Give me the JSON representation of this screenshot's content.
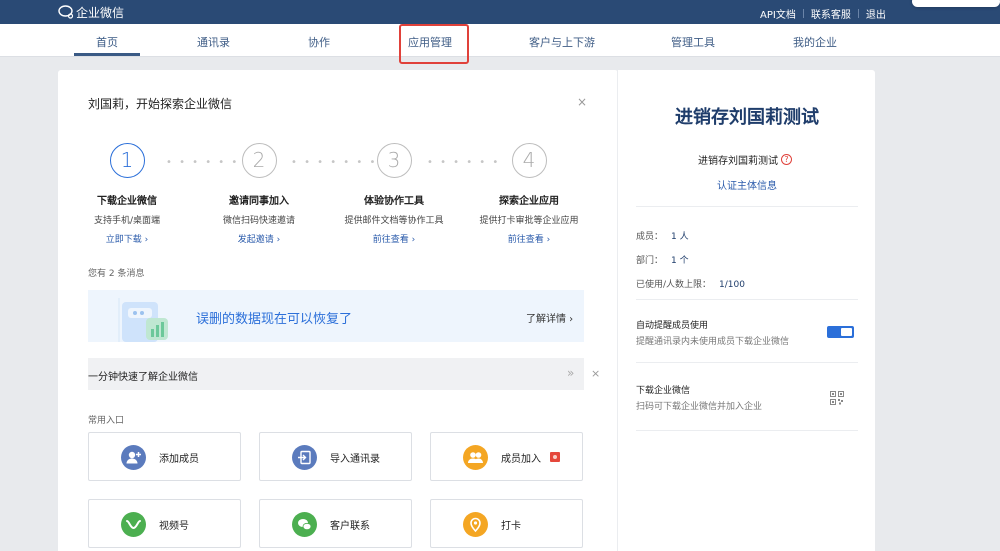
{
  "app": {
    "logo_text": "企业微信"
  },
  "top_links": [
    "API文档",
    "联系客服",
    "退出"
  ],
  "nav": [
    "首页",
    "通讯录",
    "协作",
    "应用管理",
    "客户与上下游",
    "管理工具",
    "我的企业"
  ],
  "greeting": "刘国莉，开始探索企业微信",
  "close_glyph": "×",
  "steps": [
    {
      "num": "1",
      "title": "下载企业微信",
      "desc": "支持手机/桌面端",
      "link": "立即下载 ›"
    },
    {
      "num": "2",
      "title": "邀请同事加入",
      "desc": "微信扫码快速邀请",
      "link": "发起邀请 ›"
    },
    {
      "num": "3",
      "title": "体验协作工具",
      "desc": "提供邮件文档等协作工具",
      "link": "前往查看 ›"
    },
    {
      "num": "4",
      "title": "探索企业应用",
      "desc": "提供打卡审批等企业应用",
      "link": "前往查看 ›"
    }
  ],
  "messages_count": "您有 2 条消息",
  "banner": {
    "title": "误删的数据现在可以恢复了",
    "link": "了解详情 ›"
  },
  "quick_intro": {
    "text": "一分钟快速了解企业微信",
    "arrow": "»"
  },
  "common_label": "常用入口",
  "tiles": [
    {
      "label": "添加成员",
      "icon": "add-person-icon",
      "color": "#5b7bbd"
    },
    {
      "label": "导入通讯录",
      "icon": "import-icon",
      "color": "#5b7bbd"
    },
    {
      "label": "成员加入",
      "icon": "people-icon",
      "color": "#f4a623"
    },
    {
      "label": "视频号",
      "icon": "channels-icon",
      "color": "#4caf50"
    },
    {
      "label": "客户联系",
      "icon": "wechat-icon",
      "color": "#4caf50"
    },
    {
      "label": "打卡",
      "icon": "location-icon",
      "color": "#f4a623"
    }
  ],
  "side": {
    "corp_name": "进销存刘国莉测试",
    "corp_sub": "进销存刘国莉测试",
    "help_glyph": "?",
    "verify": "认证主体信息",
    "members_label": "成员：",
    "members_value": "1 人",
    "depts_label": "部门：",
    "depts_value": "1 个",
    "limit_label": "已使用/人数上限：",
    "limit_value": "1/100",
    "auto_remind_title": "自动提醒成员使用",
    "auto_remind_desc": "提醒通讯录内未使用成员下载企业微信",
    "auto_remind_on": true,
    "download_title": "下载企业微信",
    "download_desc": "扫码可下载企业微信并加入企业"
  },
  "colors": {
    "topbar": "#2a4a75",
    "accent": "#2b6fd9",
    "highlight": "#e0413a"
  }
}
